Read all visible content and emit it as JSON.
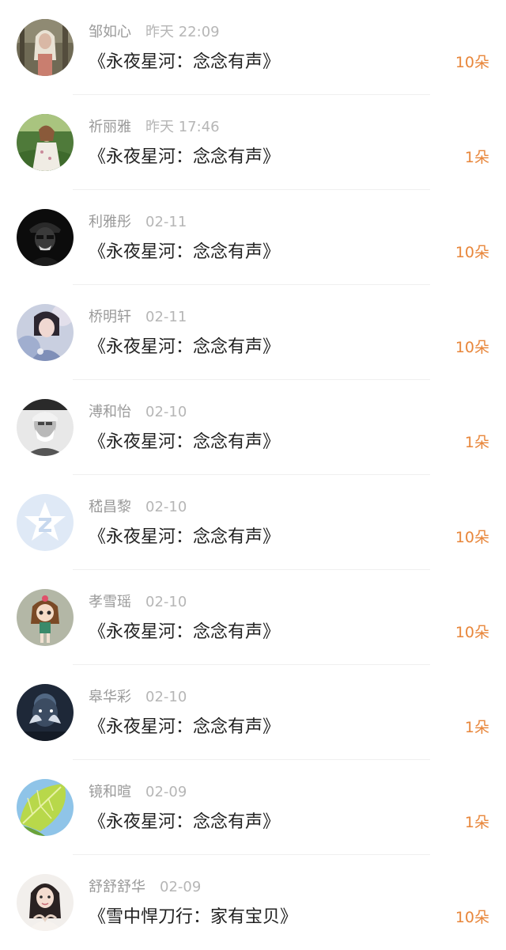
{
  "theme": {
    "accent": "#e8863a",
    "title_color": "#222222",
    "meta_color": "#a9a9a9"
  },
  "items": [
    {
      "name": "邹如心",
      "time": "昨天 22:09",
      "title": "《永夜星河：念念有声》",
      "count": "10朵",
      "avatar": "photo-forest-girl"
    },
    {
      "name": "祈丽雅",
      "time": "昨天 17:46",
      "title": "《永夜星河：念念有声》",
      "count": "1朵",
      "avatar": "photo-girl-in-field"
    },
    {
      "name": "利雅彤",
      "time": "02-11",
      "title": "《永夜星河：念念有声》",
      "count": "10朵",
      "avatar": "photo-dark-figure"
    },
    {
      "name": "桥明轩",
      "time": "02-11",
      "title": "《永夜星河：念念有声》",
      "count": "10朵",
      "avatar": "photo-blurred-girl"
    },
    {
      "name": "溥和怡",
      "time": "02-10",
      "title": "《永夜星河：念念有声》",
      "count": "1朵",
      "avatar": "photo-old-man-bw"
    },
    {
      "name": "嵇昌黎",
      "time": "02-10",
      "title": "《永夜星河：念念有声》",
      "count": "10朵",
      "avatar": "qq-default-star"
    },
    {
      "name": "孝雪瑶",
      "time": "02-10",
      "title": "《永夜星河：念念有声》",
      "count": "10朵",
      "avatar": "cartoon-girl"
    },
    {
      "name": "皋华彩",
      "time": "02-10",
      "title": "《永夜星河：念念有声》",
      "count": "1朵",
      "avatar": "photo-dark-hands"
    },
    {
      "name": "镜和暄",
      "time": "02-09",
      "title": "《永夜星河：念念有声》",
      "count": "1朵",
      "avatar": "photo-green-leaf"
    },
    {
      "name": "舒舒舒华",
      "time": "02-09",
      "title": "《雪中悍刀行：家有宝贝》",
      "count": "10朵",
      "avatar": "photo-woman-portrait"
    }
  ]
}
